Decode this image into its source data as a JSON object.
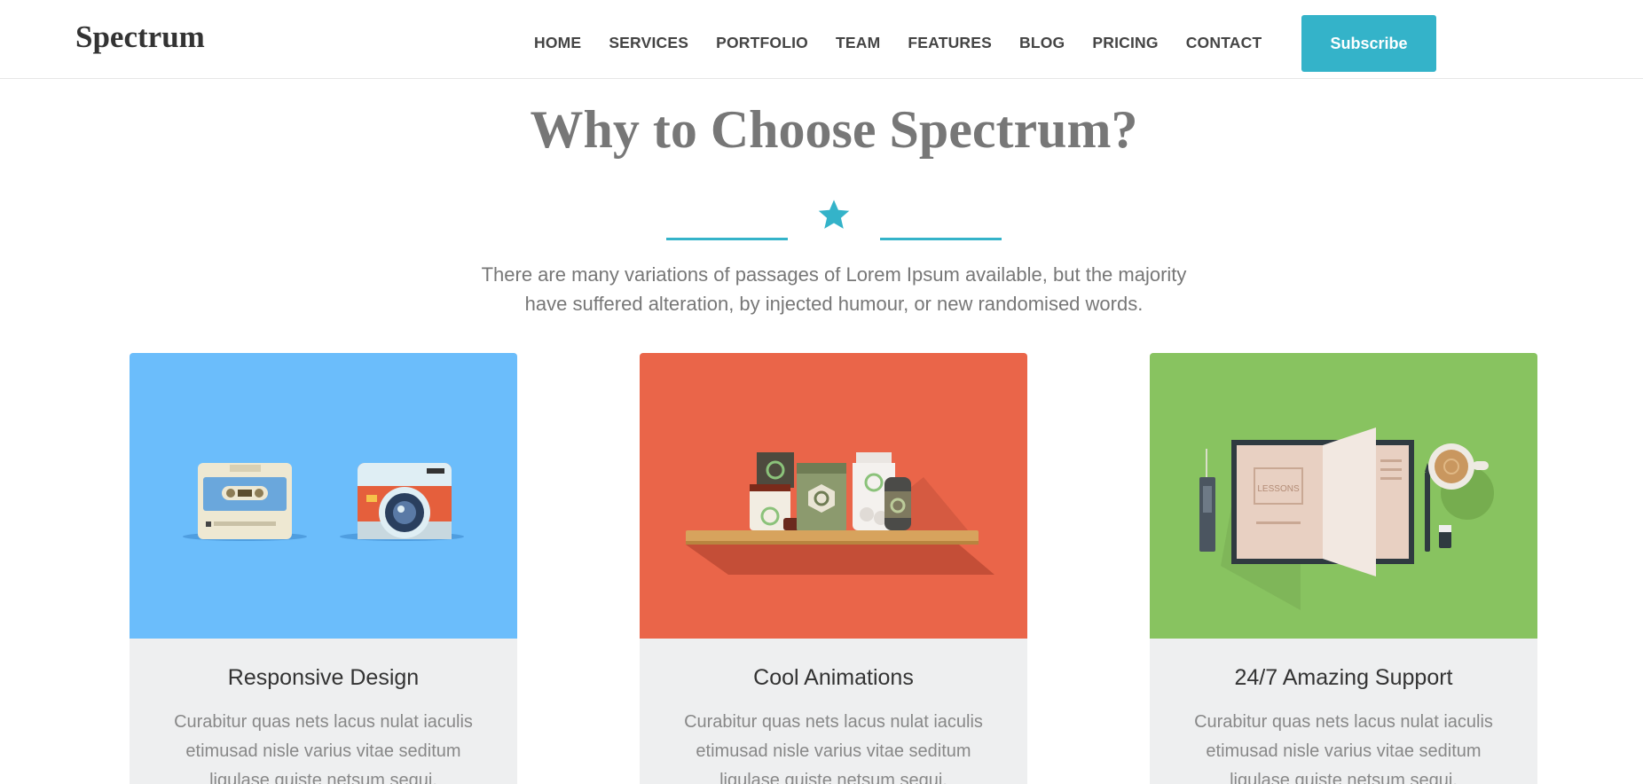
{
  "header": {
    "logo": "Spectrum",
    "nav": [
      "HOME",
      "SERVICES",
      "PORTFOLIO",
      "TEAM",
      "FEATURES",
      "BLOG",
      "PRICING",
      "CONTACT"
    ],
    "subscribe_label": "Subscribe"
  },
  "section": {
    "title": "Why to Choose Spectrum?",
    "description_line1": "There are many variations of passages of Lorem Ipsum available, but the majority",
    "description_line2": "have suffered alteration, by injected humour, or new randomised words.",
    "divider_icon": "star-icon"
  },
  "cards": [
    {
      "title": "Responsive Design",
      "text": "Curabitur quas nets lacus nulat iaculis etimusad nisle varius vitae seditum ligulase quiste netsum sequi.",
      "illustration": "cassette-and-camera-illustration"
    },
    {
      "title": "Cool Animations",
      "text": "Curabitur quas nets lacus nulat iaculis etimusad nisle varius vitae seditum ligulase quiste netsum sequi.",
      "illustration": "jars-on-shelf-illustration"
    },
    {
      "title": "24/7 Amazing Support",
      "text": "Curabitur quas nets lacus nulat iaculis etimusad nisle varius vitae seditum ligulase quiste netsum sequi.",
      "illustration": "book-and-coffee-illustration",
      "book_label": "LESSONS"
    }
  ],
  "colors": {
    "accent": "#34b3c9",
    "card1_bg": "#6bbdfb",
    "card2_bg": "#ea6549",
    "card3_bg": "#88c360"
  }
}
